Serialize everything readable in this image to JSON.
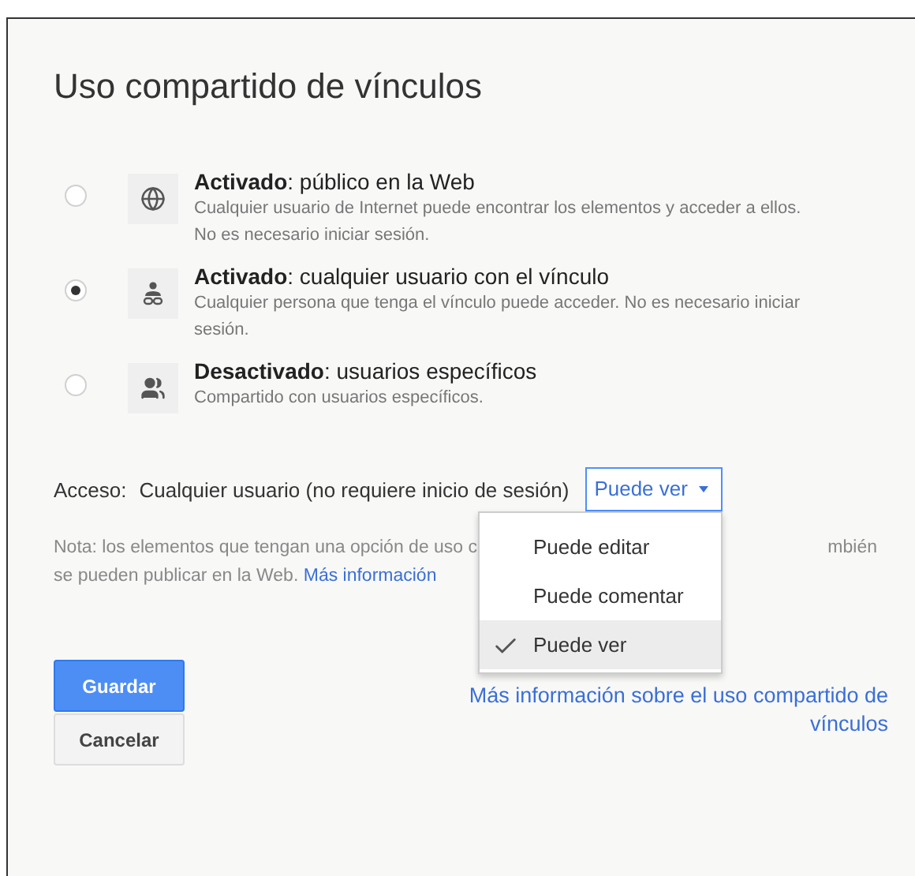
{
  "dialog": {
    "title": "Uso compartido de vínculos"
  },
  "options": [
    {
      "kind": "public",
      "strong": "Activado",
      "title": ": público en la Web",
      "description": "Cualquier usuario de Internet puede encontrar los elementos y acceder a ellos. No es necesario iniciar sesión.",
      "selected": false
    },
    {
      "kind": "link",
      "strong": "Activado",
      "title": ": cualquier usuario con el vínculo",
      "description": "Cualquier persona que tenga el vínculo puede acceder. No es necesario iniciar sesión.",
      "selected": true
    },
    {
      "kind": "specific",
      "strong": "Desactivado",
      "title": ": usuarios específicos",
      "description": "Compartido con usuarios específicos.",
      "selected": false
    }
  ],
  "access": {
    "label": "Acceso:",
    "value": "Cualquier usuario (no requiere inicio de sesión)",
    "dropdown": "Puede ver"
  },
  "menu": [
    {
      "label": "Puede editar",
      "selected": false
    },
    {
      "label": "Puede comentar",
      "selected": false
    },
    {
      "label": "Puede ver",
      "selected": true
    }
  ],
  "note": {
    "line1_start": "Nota: los elementos que tengan una opción de uso c",
    "line1_end": "mbién",
    "line2": "se pueden publicar en la Web.",
    "link": "Más información"
  },
  "buttons": {
    "save": "Guardar",
    "cancel": "Cancelar"
  },
  "help_link": "Más información sobre el uso compartido de vínculos"
}
